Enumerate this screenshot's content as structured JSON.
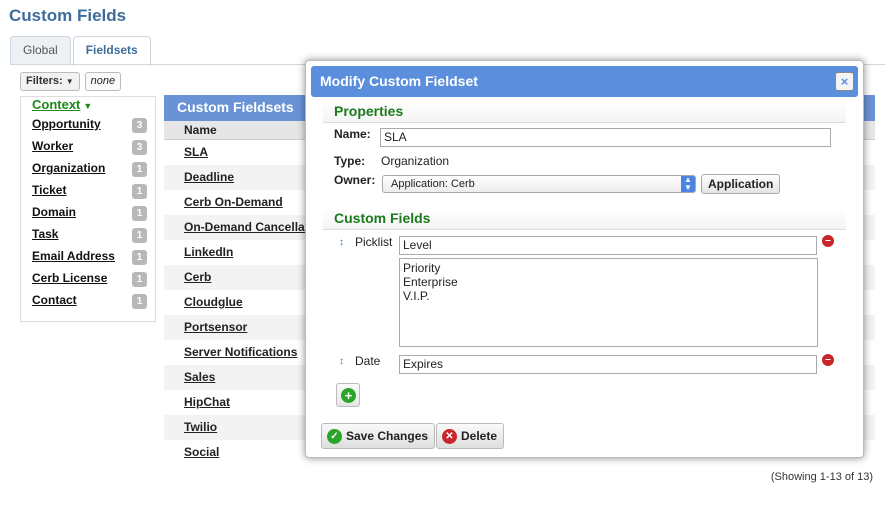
{
  "page": {
    "title": "Custom Fields"
  },
  "tabs": [
    {
      "label": "Global"
    },
    {
      "label": "Fieldsets"
    }
  ],
  "filters": {
    "label": "Filters:",
    "value": "none"
  },
  "context": {
    "title": "Context",
    "items": [
      {
        "label": "Opportunity",
        "count": "3"
      },
      {
        "label": "Worker",
        "count": "3"
      },
      {
        "label": "Organization",
        "count": "1"
      },
      {
        "label": "Ticket",
        "count": "1"
      },
      {
        "label": "Domain",
        "count": "1"
      },
      {
        "label": "Task",
        "count": "1"
      },
      {
        "label": "Email Address",
        "count": "1"
      },
      {
        "label": "Cerb License",
        "count": "1"
      },
      {
        "label": "Contact",
        "count": "1"
      }
    ]
  },
  "fieldsets": {
    "header": "Custom Fieldsets",
    "column": "Name",
    "rows": [
      "SLA",
      "Deadline",
      "Cerb On-Demand",
      "On-Demand Cancellation",
      "LinkedIn",
      "Cerb",
      "Cloudglue",
      "Portsensor",
      "Server Notifications",
      "Sales",
      "HipChat",
      "Twilio",
      "Social"
    ],
    "showing": "(Showing 1-13 of 13)"
  },
  "modal": {
    "title": "Modify Custom Fieldset",
    "close_label": "×",
    "properties": {
      "title": "Properties",
      "name_label": "Name:",
      "name_value": "SLA",
      "type_label": "Type:",
      "type_value": "Organization",
      "owner_label": "Owner:",
      "owner_value": "Application: Cerb",
      "owner_button": "Application"
    },
    "custom_fields": {
      "title": "Custom Fields",
      "fields": [
        {
          "type": "Picklist",
          "name": "Level",
          "options": [
            "Priority",
            "Enterprise",
            "V.I.P."
          ]
        },
        {
          "type": "Date",
          "name": "Expires"
        }
      ]
    },
    "save_label": "Save Changes",
    "delete_label": "Delete"
  },
  "colors": {
    "header_blue": "#6a93d6",
    "title_blue": "#3e6d9c",
    "section_green": "#1b7a1b",
    "remove_red": "#c9262c",
    "add_green": "#2aa52a"
  },
  "icons": [
    "chevron-down-icon",
    "close-icon",
    "sort-handle-icon",
    "remove-icon",
    "add-icon",
    "check-icon",
    "delete-icon"
  ]
}
